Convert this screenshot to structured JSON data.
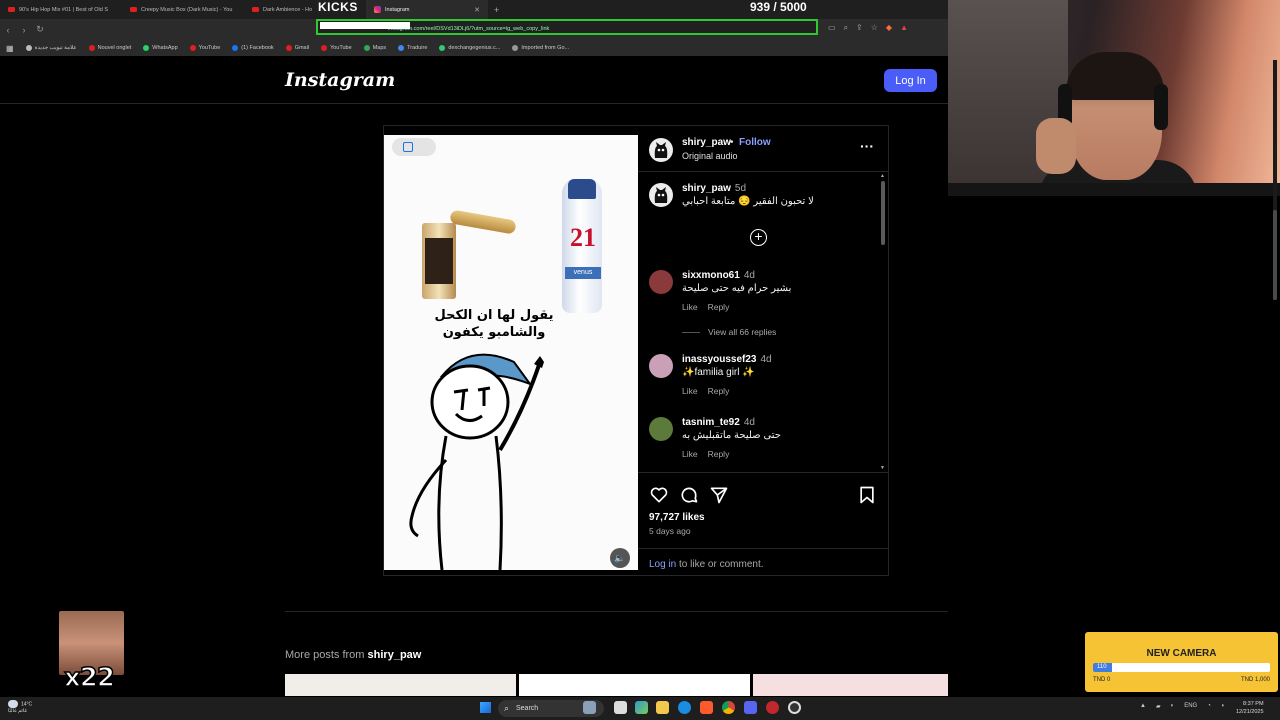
{
  "browser": {
    "tabs": [
      {
        "label": "90's Hip Hop Mix #01 | Best of Old S",
        "kind": "youtube"
      },
      {
        "label": "Creepy Music Box (Dark Music) - You",
        "kind": "youtube"
      },
      {
        "label": "Dark Ambience - Ho",
        "kind": "youtube"
      },
      {
        "label": "Instagram",
        "kind": "instagram",
        "active": true
      }
    ],
    "new_tab": "+",
    "url_fragment": "instagram.com/reel/DSVd13iDLj6/?utm_source=ig_web_copy_link",
    "bookmarks": [
      {
        "label": "علامة تبويب جديدة",
        "color": "#bbbbbb"
      },
      {
        "label": "Nouvel onglet",
        "color": "#e02020"
      },
      {
        "label": "WhatsApp",
        "color": "#25d366"
      },
      {
        "label": "YouTube",
        "color": "#e02020"
      },
      {
        "label": "(1) Facebook",
        "color": "#1877f2"
      },
      {
        "label": "Gmail",
        "color": "#e02020"
      },
      {
        "label": "YouTube",
        "color": "#e02020"
      },
      {
        "label": "Maps",
        "color": "#34a853"
      },
      {
        "label": "Traduire",
        "color": "#4285f4"
      },
      {
        "label": "dexchangegenius.c...",
        "color": "#2ecc71"
      },
      {
        "label": "Imported from Go...",
        "color": "#999999"
      }
    ]
  },
  "overlay": {
    "kicks_label": "KICKS",
    "counter": "939 / 5000",
    "emote_count": "x22",
    "goal": {
      "title": "NEW CAMERA",
      "current": "110",
      "progress_fraction": 0.11,
      "min_label": "TND 0",
      "max_label": "TND 1,000"
    }
  },
  "instagram": {
    "logo": "Instagram",
    "login_button": "Log In",
    "post": {
      "username": "shiry_paw",
      "dot": "•",
      "follow": "Follow",
      "audio": "Original audio",
      "more_icon": "more-horizontal-icon",
      "media_text": "يقول لها ان الكحل والشامبو يكفون",
      "caption": {
        "user": "shiry_paw",
        "time": "5d",
        "text": "لا تحبون الفقير 😔 متابعة احبابي"
      },
      "comments": [
        {
          "user": "sixxmono61",
          "time": "4d",
          "text": "بشير حرام فيه حتى صليحة",
          "like": "Like",
          "reply": "Reply",
          "avatar_color": "#8a3a3a"
        },
        {
          "user": "inassyoussef23",
          "time": "4d",
          "text": "✨familia girl ✨",
          "like": "Like",
          "reply": "Reply",
          "avatar_color": "#c9a0b8"
        },
        {
          "user": "tasnim_te92",
          "time": "4d",
          "text": "حتى صليحة ماتقبليش به",
          "like": "Like",
          "reply": "Reply",
          "avatar_color": "#5c7a3a"
        }
      ],
      "view_replies": "View all 66 replies",
      "likes": "97,727 likes",
      "posted": "5 days ago",
      "login_link": "Log in",
      "login_rest": " to like or comment."
    },
    "more_posts_prefix": "More posts from ",
    "more_posts_user": "shiry_paw"
  },
  "taskbar": {
    "weather_temp": "14°C",
    "weather_desc": "غائم غالبًا",
    "search": "Search",
    "lang": "ENG",
    "time": "8:37 PM",
    "date": "12/21/2025"
  }
}
